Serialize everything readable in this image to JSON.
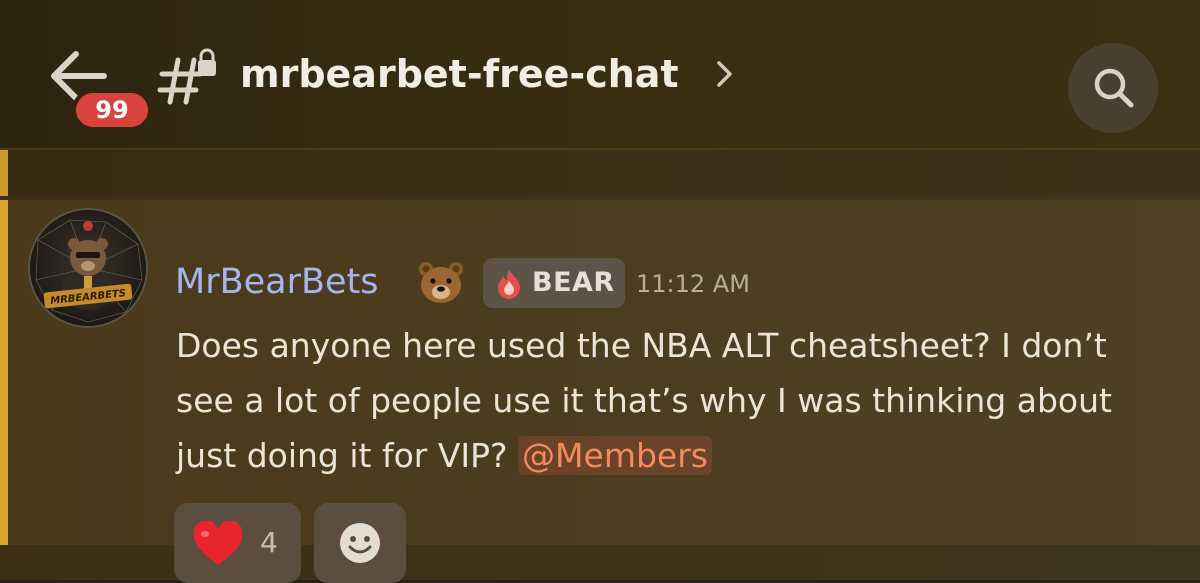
{
  "header": {
    "back_icon": "arrow-left-icon",
    "unread_badge": "99",
    "channel_icon": "locked-text-channel-icon",
    "channel_name": "mrbearbet-free-chat",
    "chevron_icon": "chevron-right-icon",
    "search_icon": "search-icon"
  },
  "message": {
    "author": "MrBearBets",
    "author_emoji": "🐻",
    "avatar_text": "MRBEARBETS",
    "role_tag": {
      "icon": "flame-icon",
      "label": "BEAR"
    },
    "timestamp": "11:12 AM",
    "text_before_mention": "Does anyone here used the NBA ALT cheatsheet? I don’t see a lot of people use it that’s why I was thinking about just doing it for VIP?",
    "mention": "@Members",
    "reactions": [
      {
        "emoji": "❤️",
        "icon": "red-heart-icon",
        "count": "4"
      }
    ],
    "add_reaction_icon": "add-reaction-smiley-icon"
  },
  "colors": {
    "accent_bar": "#d8a72f",
    "username": "#a4b6ef",
    "badge": "#d8433f",
    "mention_text": "#f28a5c"
  }
}
